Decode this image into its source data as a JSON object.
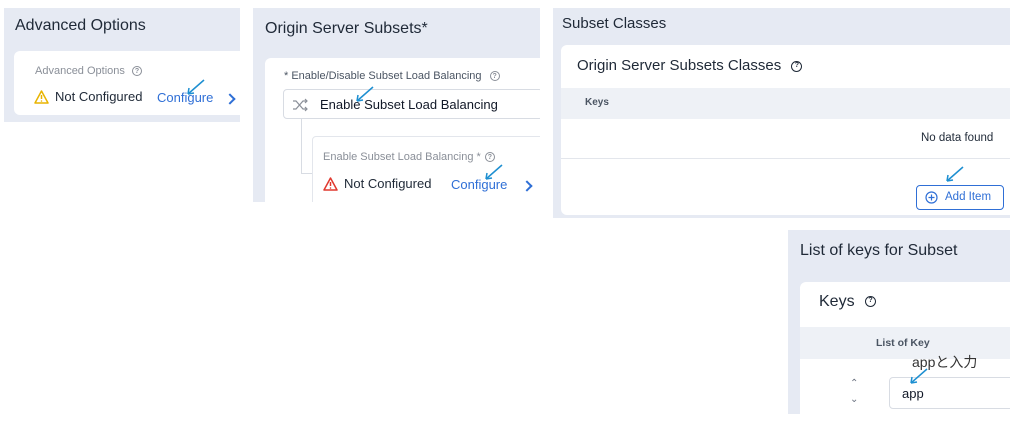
{
  "panel1": {
    "title": "Advanced Options",
    "field_label": "Advanced Options",
    "status": "Not Configured",
    "configure": "Configure"
  },
  "panel2": {
    "title": "Origin Server Subsets*",
    "field_label": "* Enable/Disable Subset Load Balancing",
    "select_value": "Enable Subset Load Balancing",
    "nested_label": "Enable Subset Load Balancing *",
    "status": "Not Configured",
    "configure": "Configure"
  },
  "panel3": {
    "title": "Subset Classes",
    "section_title": "Origin Server Subsets Classes",
    "column_header": "Keys",
    "empty_text": "No data found",
    "add_button": "Add Item"
  },
  "panel4": {
    "title": "List of keys for Subset",
    "section_title": "Keys",
    "column_header": "List of Key",
    "annotation": "appと入力",
    "input_value": "app"
  },
  "colors": {
    "panel_bg": "#e6eaf3",
    "accent": "#2f6fd6",
    "warning": "#e8b400",
    "error": "#e0382f",
    "annotation_arrow": "#1d8fd1"
  }
}
